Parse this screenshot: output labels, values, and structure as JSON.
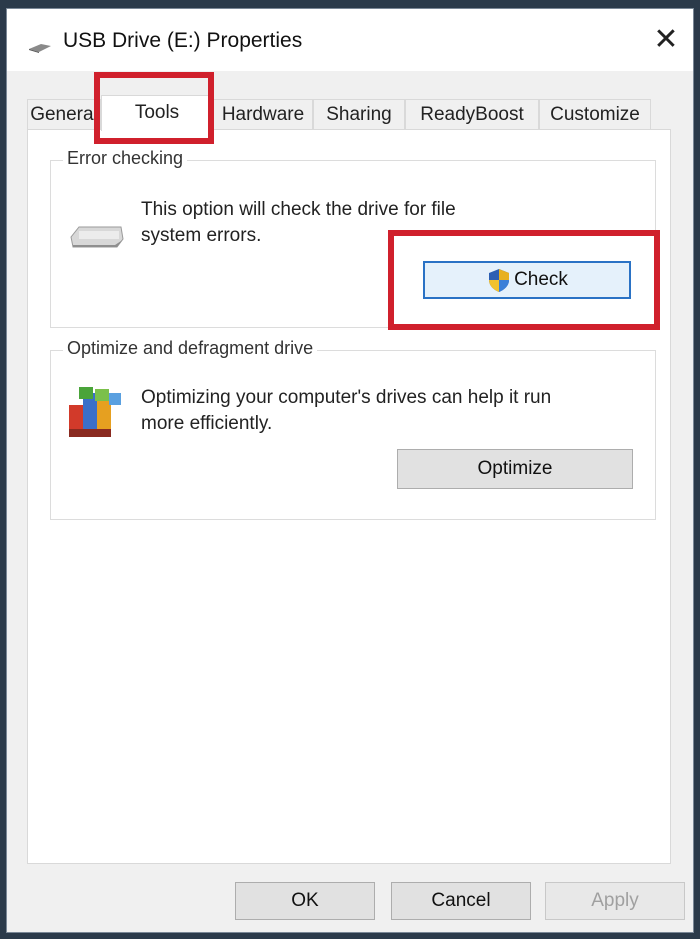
{
  "window": {
    "title": "USB Drive (E:) Properties",
    "close_glyph": "✕"
  },
  "tabs": [
    {
      "label": "General",
      "active": false
    },
    {
      "label": "Tools",
      "active": true
    },
    {
      "label": "Hardware",
      "active": false
    },
    {
      "label": "Sharing",
      "active": false
    },
    {
      "label": "ReadyBoost",
      "active": false
    },
    {
      "label": "Customize",
      "active": false
    }
  ],
  "error_checking": {
    "title": "Error checking",
    "description_line1": "This option will check the drive for file",
    "description_line2": "system errors.",
    "check_label": "Check"
  },
  "optimize": {
    "title": "Optimize and defragment drive",
    "description_line1": "Optimizing your computer's drives can help it run",
    "description_line2": "more efficiently.",
    "optimize_label": "Optimize"
  },
  "footer": {
    "ok_label": "OK",
    "cancel_label": "Cancel",
    "apply_label": "Apply"
  },
  "colors": {
    "highlight": "#d0202c",
    "focus": "#2a72c5"
  }
}
